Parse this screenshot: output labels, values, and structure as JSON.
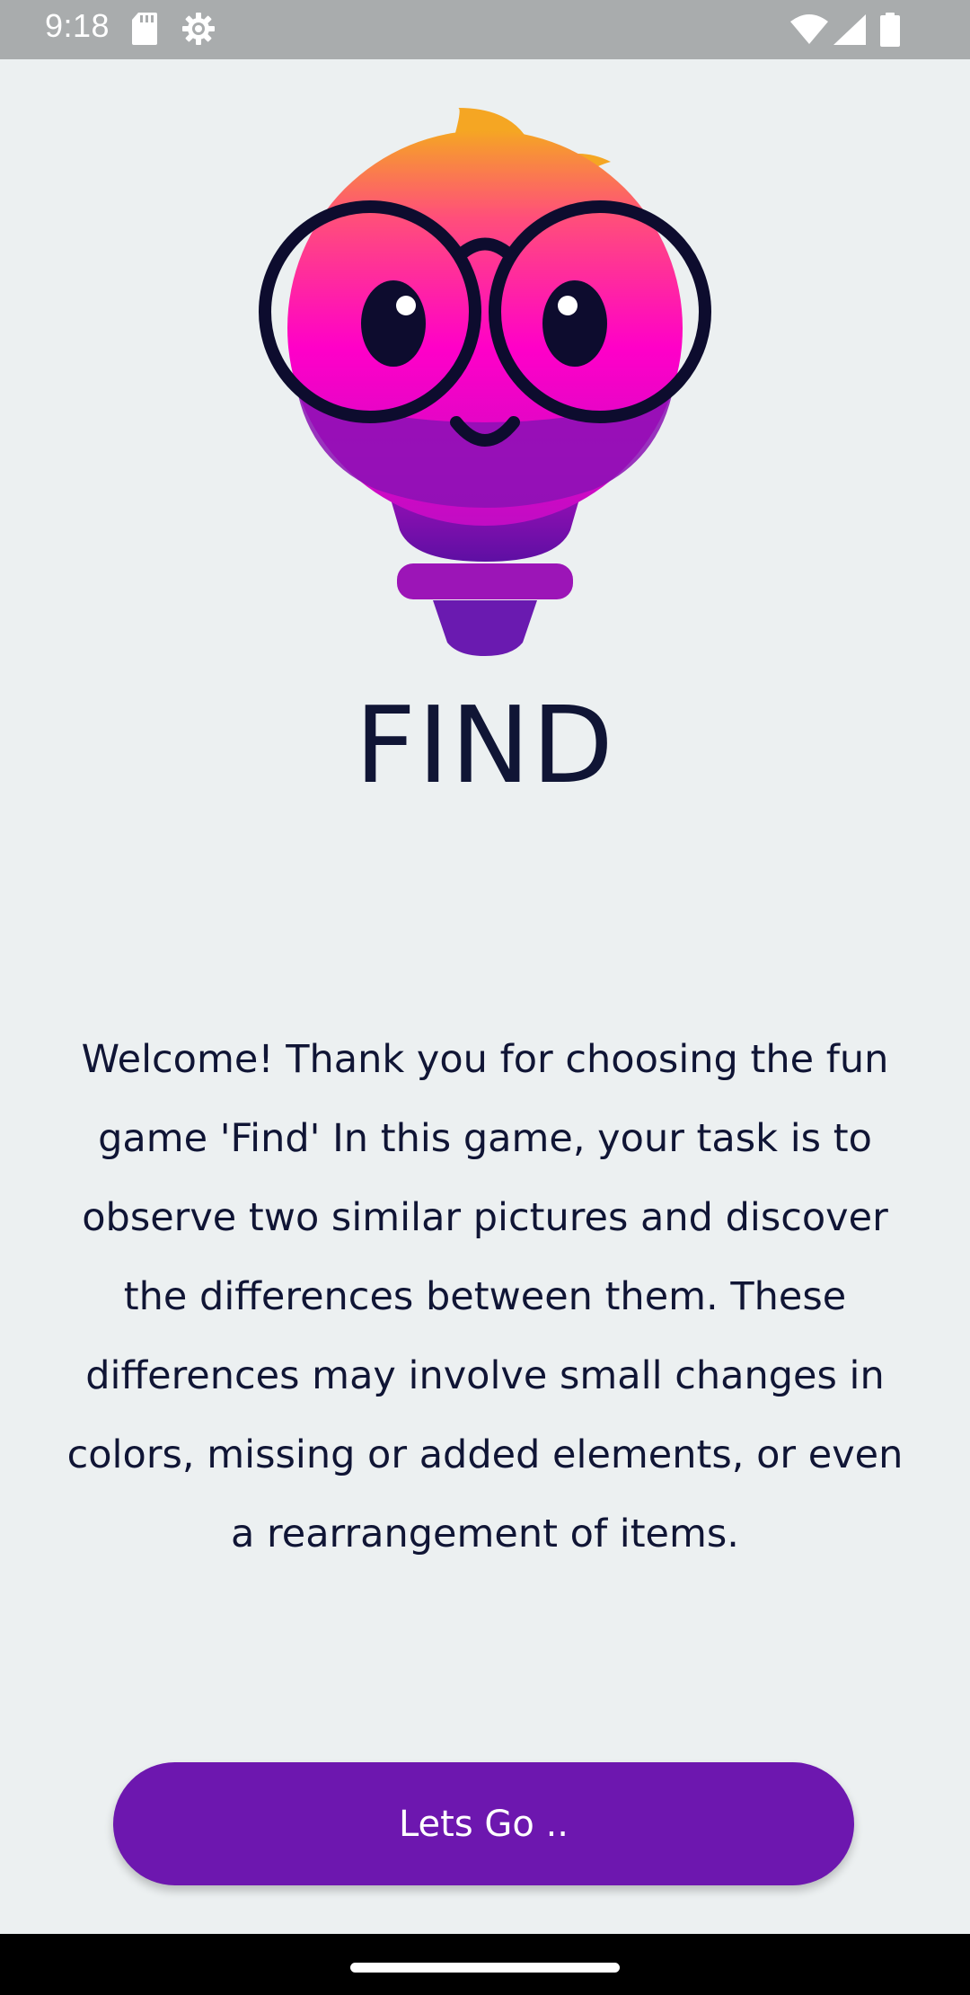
{
  "status_bar": {
    "time": "9:18",
    "icons": [
      "sd-card-icon",
      "settings-icon",
      "wifi-icon",
      "signal-icon",
      "battery-icon"
    ]
  },
  "logo": {
    "icon": "lightbulb-mascot-icon",
    "colors": {
      "hair": "#f5a623",
      "head_top": "#ff3d8a",
      "head_mid": "#ff00c8",
      "body": "#7a14b8",
      "glasses": "#0d0c2e"
    }
  },
  "app_name": "FIND",
  "welcome_text": "Welcome! Thank you for choosing the fun game 'Find' In this game, your task is to observe two similar pictures and discover the differences between them. These differences may involve small changes in colors, missing or added elements, or even a rearrangement of items.",
  "primary_button": {
    "label": "Lets Go ..",
    "color": "#6d17af"
  },
  "theme": {
    "background": "#ecf0f1",
    "text": "#101535",
    "status_bar": "#a9acad"
  }
}
